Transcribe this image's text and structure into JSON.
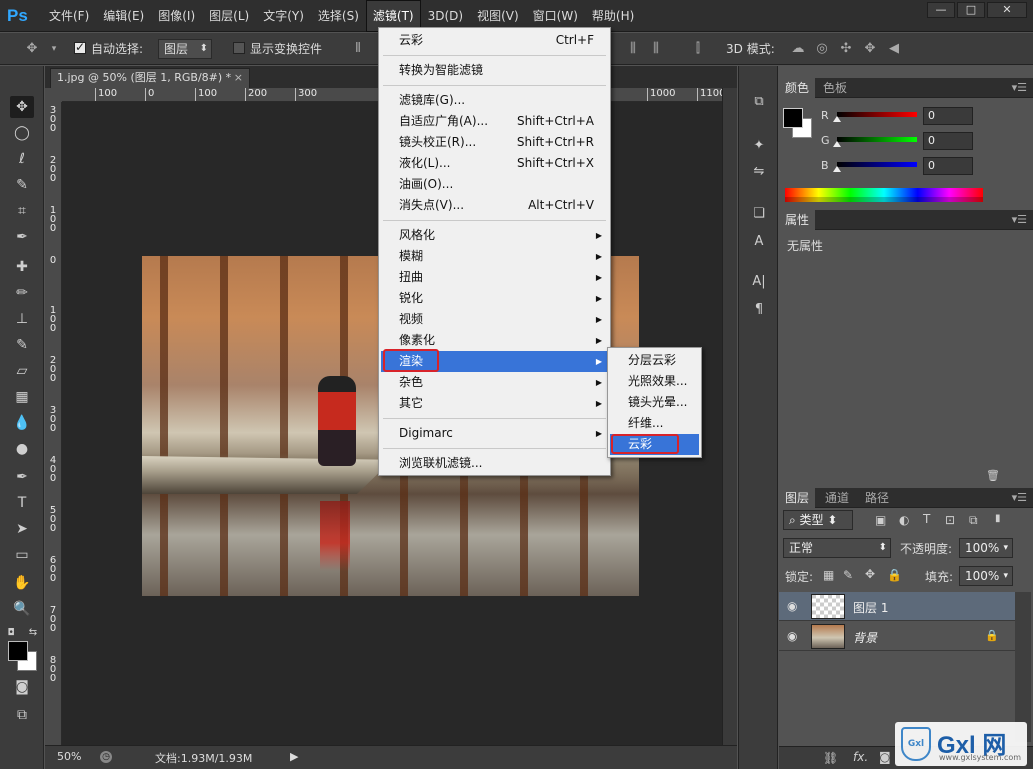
{
  "app": {
    "logo": "Ps",
    "menu": [
      "文件(F)",
      "编辑(E)",
      "图像(I)",
      "图层(L)",
      "文字(Y)",
      "选择(S)",
      "滤镜(T)",
      "3D(D)",
      "视图(V)",
      "窗口(W)",
      "帮助(H)"
    ],
    "active_menu_index": 6,
    "window_controls": [
      "—",
      "□",
      "✕"
    ]
  },
  "options": {
    "auto_select_label": "自动选择:",
    "auto_select_checked": true,
    "layer_select": "图层",
    "show_transform_label": "显示变换控件",
    "mode_3d_label": "3D 模式:"
  },
  "document": {
    "tab_title": "1.jpg @ 50% (图层 1, RGB/8#) *",
    "tab_close": "×",
    "ruler_top": [
      "100",
      "0",
      "100",
      "200",
      "300",
      "1000",
      "1100"
    ],
    "ruler_left": [
      "300",
      "200",
      "100",
      "0",
      "100",
      "200",
      "300",
      "400",
      "500",
      "600",
      "700",
      "800"
    ],
    "zoom": "50%",
    "doc_size": "文档:1.93M/1.93M"
  },
  "filter_menu": {
    "items": [
      {
        "label": "云彩",
        "shortcut": "Ctrl+F"
      },
      {
        "sep": true
      },
      {
        "label": "转换为智能滤镜"
      },
      {
        "sep": true
      },
      {
        "label": "滤镜库(G)..."
      },
      {
        "label": "自适应广角(A)...",
        "shortcut": "Shift+Ctrl+A"
      },
      {
        "label": "镜头校正(R)...",
        "shortcut": "Shift+Ctrl+R"
      },
      {
        "label": "液化(L)...",
        "shortcut": "Shift+Ctrl+X"
      },
      {
        "label": "油画(O)..."
      },
      {
        "label": "消失点(V)...",
        "shortcut": "Alt+Ctrl+V"
      },
      {
        "sep": true
      },
      {
        "label": "风格化",
        "submenu": true
      },
      {
        "label": "模糊",
        "submenu": true
      },
      {
        "label": "扭曲",
        "submenu": true
      },
      {
        "label": "锐化",
        "submenu": true
      },
      {
        "label": "视频",
        "submenu": true
      },
      {
        "label": "像素化",
        "submenu": true
      },
      {
        "label": "渲染",
        "submenu": true,
        "highlighted": true
      },
      {
        "label": "杂色",
        "submenu": true
      },
      {
        "label": "其它",
        "submenu": true
      },
      {
        "sep": true
      },
      {
        "label": "Digimarc",
        "submenu": true
      },
      {
        "sep": true
      },
      {
        "label": "浏览联机滤镜..."
      }
    ]
  },
  "render_submenu": {
    "items": [
      "分层云彩",
      "光照效果...",
      "镜头光晕...",
      "纤维...",
      "云彩"
    ],
    "highlighted_index": 4
  },
  "color_panel": {
    "tabs": [
      "颜色",
      "色板"
    ],
    "channels": [
      {
        "label": "R",
        "value": "0",
        "color": "#ff0000"
      },
      {
        "label": "G",
        "value": "0",
        "color": "#00ff00"
      },
      {
        "label": "B",
        "value": "0",
        "color": "#0000ff"
      }
    ]
  },
  "properties_panel": {
    "tab": "属性",
    "content": "无属性"
  },
  "layers_panel": {
    "tabs": [
      "图层",
      "通道",
      "路径"
    ],
    "filter_kind": "类型",
    "blend_mode": "正常",
    "opacity_label": "不透明度:",
    "opacity": "100%",
    "lock_label": "锁定:",
    "fill_label": "填充:",
    "fill": "100%",
    "layers": [
      {
        "name": "图层 1",
        "selected": true,
        "locked": false
      },
      {
        "name": "背景",
        "selected": false,
        "locked": true
      }
    ]
  },
  "watermark": {
    "badge": "Gxl",
    "brand": "Gxl 网",
    "url": "www.gxlsystem.com"
  }
}
